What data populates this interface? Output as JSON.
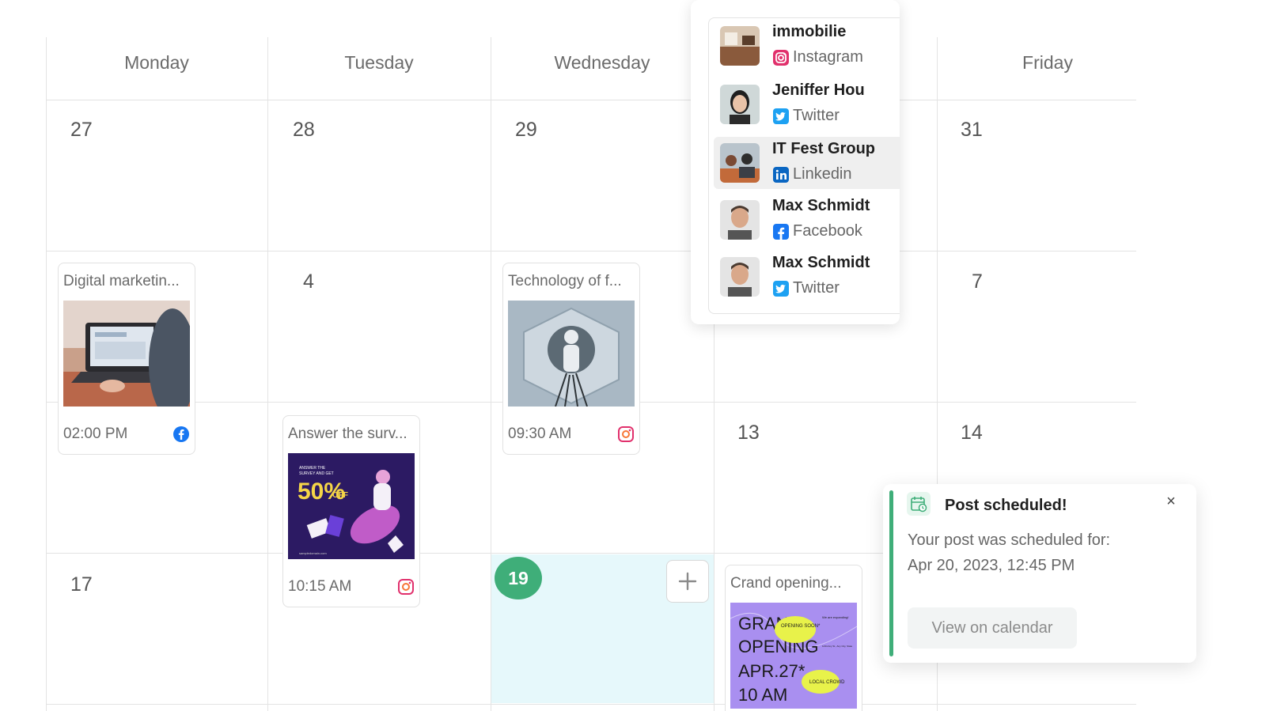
{
  "calendar": {
    "days": [
      "Monday",
      "Tuesday",
      "Wednesday",
      "Friday"
    ],
    "dates": {
      "row1": [
        "27",
        "28",
        "29",
        "31"
      ],
      "row2": [
        "4",
        "7"
      ],
      "row3": [
        "13",
        "14"
      ],
      "row4": [
        "17"
      ]
    },
    "today": "19"
  },
  "posts": [
    {
      "title": "Digital marketin...",
      "time": "02:00 PM",
      "network": "facebook-icon"
    },
    {
      "title": "Technology of f...",
      "time": "09:30 AM",
      "network": "instagram-icon"
    },
    {
      "title": "Answer the surv...",
      "time": "10:15 AM",
      "network": "instagram-icon"
    },
    {
      "title": "Crand opening...",
      "time": "",
      "network": ""
    }
  ],
  "survey_image": {
    "line1": "ANSWER THE",
    "line2": "SURVEY AND GET",
    "big": "50%",
    "off": "OFF",
    "url": "sampledomain.com"
  },
  "opening_image": {
    "l1": "GRAND",
    "l2": "OPENING",
    "l3": "APR.27*",
    "l4": "10 AM",
    "bubble1": "OPENING SOON*",
    "bubble2": "LOCAL CROWD",
    "side1": "We are expanding!",
    "side2": "1234 Any St., Any City, State"
  },
  "accounts": [
    {
      "name": "immobilie",
      "network": "Instagram"
    },
    {
      "name": "Jeniffer Hou",
      "network": "Twitter"
    },
    {
      "name": "IT Fest Group",
      "network": "Linkedin"
    },
    {
      "name": "Max Schmidt",
      "network": "Facebook"
    },
    {
      "name": "Max Schmidt",
      "network": "Twitter"
    }
  ],
  "toast": {
    "title": "Post scheduled!",
    "line1": "Your post was scheduled for:",
    "line2": "Apr 20, 2023, 12:45 PM",
    "button": "View on calendar",
    "close": "×"
  },
  "colors": {
    "accent_green": "#3fae79",
    "today_bg": "#e6f8fb",
    "instagram": "#e1306c",
    "twitter": "#1da1f2",
    "linkedin": "#0a66c2",
    "facebook": "#1877f2"
  }
}
